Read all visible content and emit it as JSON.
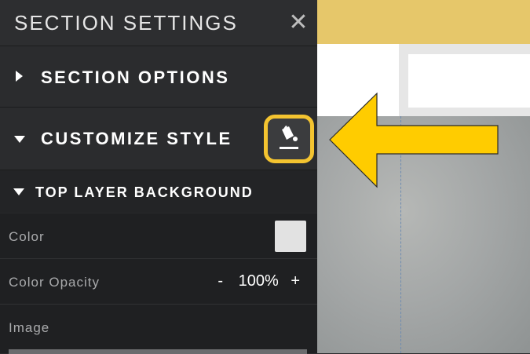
{
  "panel": {
    "title": "SECTION SETTINGS",
    "close_glyph": "✕",
    "section_options_label": "SECTION OPTIONS",
    "customize_style_label": "CUSTOMIZE STYLE",
    "top_layer_label": "TOP LAYER BACKGROUND",
    "properties": {
      "color_label": "Color",
      "color_value": "#e2e2e2",
      "opacity_label": "Color Opacity",
      "opacity_minus": "-",
      "opacity_value": "100%",
      "opacity_plus": "+",
      "image_label": "Image"
    }
  },
  "annotation": {
    "highlight_color": "#f4c430",
    "arrow_color": "#ffcc00"
  },
  "icons": {
    "paint_bucket": "paint-bucket-icon",
    "close": "close-icon",
    "expand": "triangle-right-icon",
    "collapse": "triangle-down-icon"
  }
}
